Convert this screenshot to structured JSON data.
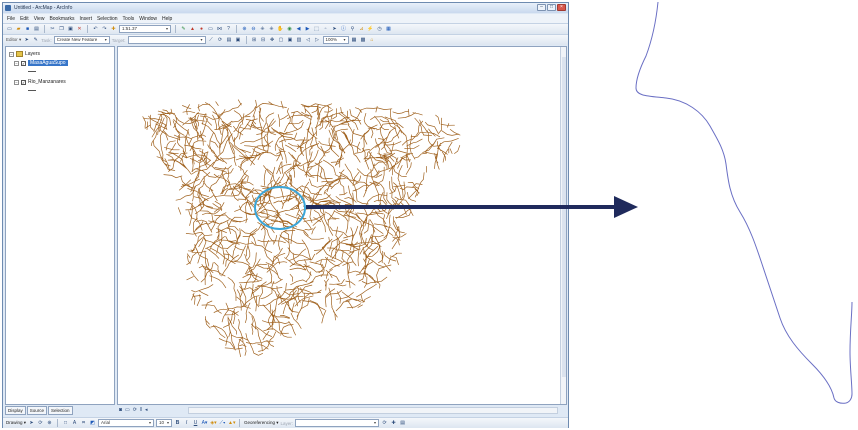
{
  "window": {
    "title": "Untitled - ArcMap - ArcInfo"
  },
  "menu": [
    "File",
    "Edit",
    "View",
    "Bookmarks",
    "Insert",
    "Selection",
    "Tools",
    "Window",
    "Help"
  ],
  "toolbar": {
    "scale_value": "1:51.37"
  },
  "editor": {
    "editor_label": "Editor ▾",
    "task_label": "Task:",
    "task_value": "Create New Feature",
    "target_label": "Target:",
    "target_value": "",
    "zoom_value": "100%"
  },
  "toc": {
    "root_label": "Layers",
    "layers": [
      {
        "name": "MasaAguaSupo",
        "checked": true,
        "selected": true
      },
      {
        "name": "Rio_Manzanares",
        "checked": true,
        "selected": false
      }
    ],
    "tabs": [
      "Display",
      "Source",
      "Selection"
    ]
  },
  "drawing_toolbar": {
    "drawing_label": "Drawing ▾",
    "font_value": "Arial",
    "size_value": "10",
    "bold": "B",
    "italic": "I",
    "underline": "U",
    "georef_label": "Georeferencing ▾",
    "layer_label": "Layer:"
  },
  "colors": {
    "rivers": "#a0621f",
    "highlight_circle": "#3aa5d8",
    "arrow": "#1f2a5c",
    "detail_river": "#6a6fc4",
    "selection": "#3675c9"
  },
  "icons": {
    "new": "new-document-icon",
    "open": "open-folder-icon",
    "save": "save-icon",
    "print": "print-icon",
    "zoom_in": "zoom-in-icon",
    "zoom_out": "zoom-out-icon",
    "pan": "pan-hand-icon",
    "identify": "identify-icon"
  }
}
